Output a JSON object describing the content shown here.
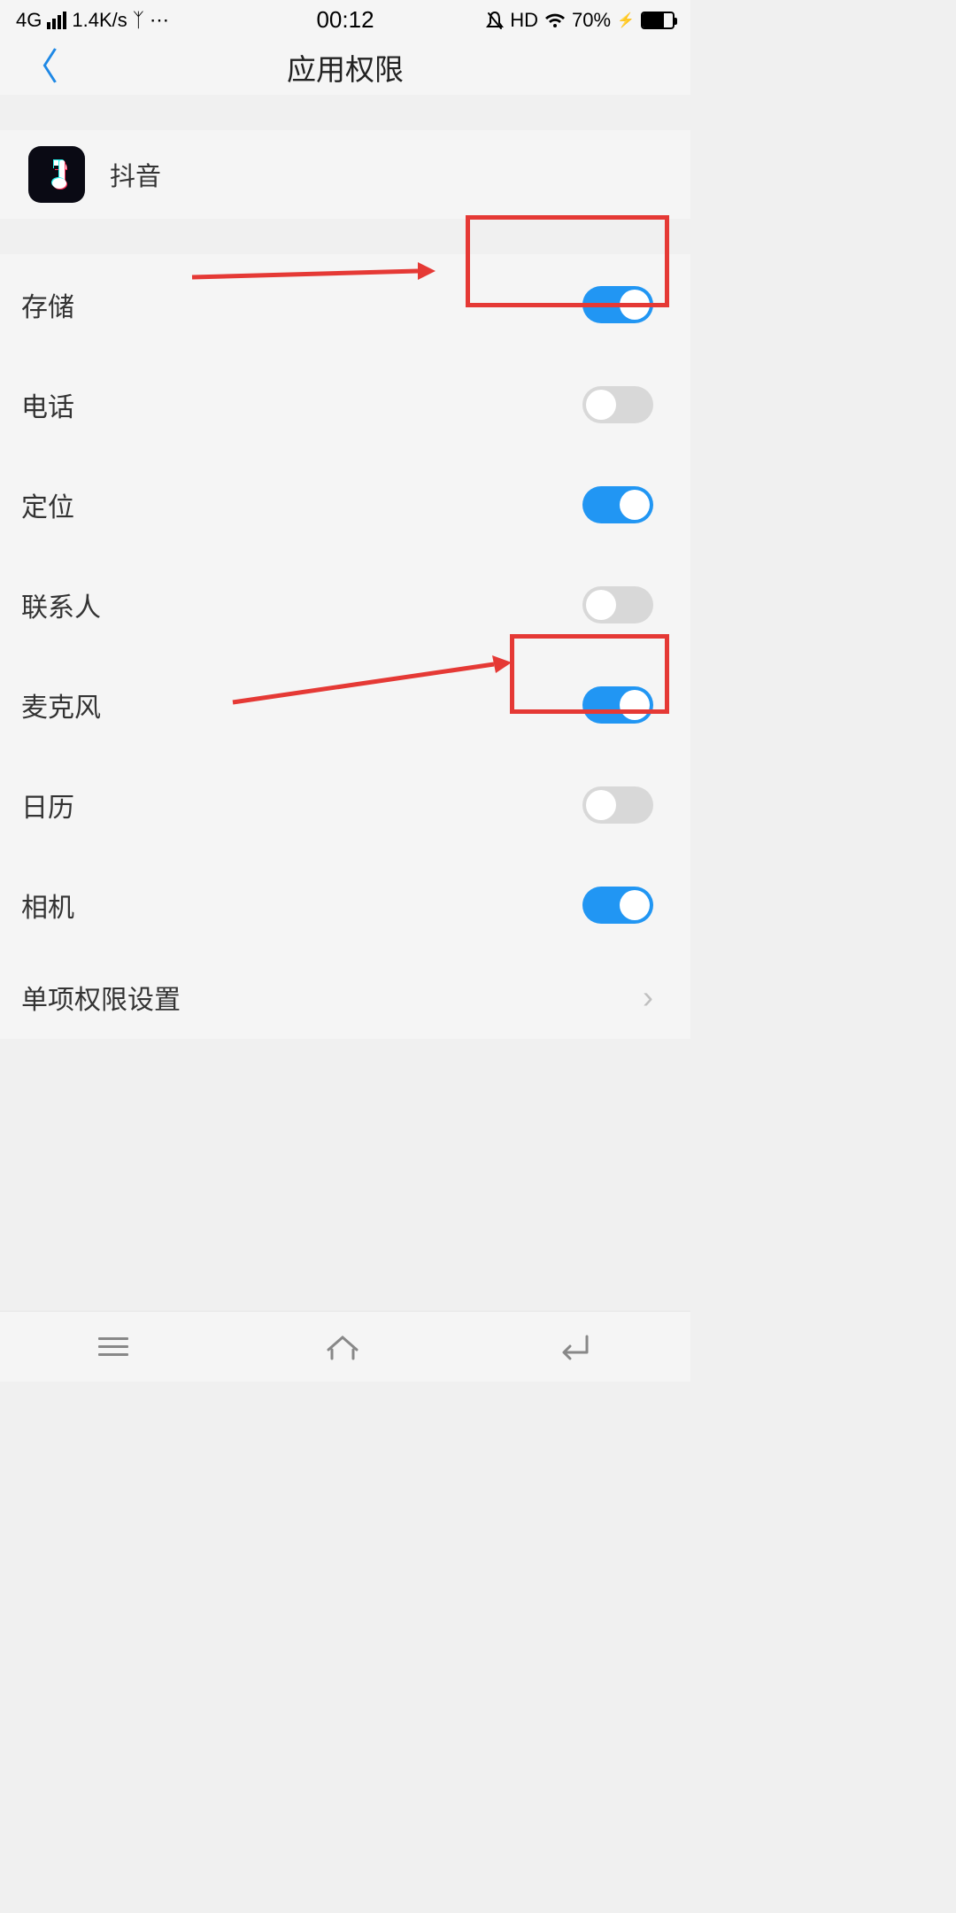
{
  "statusBar": {
    "network": "4G",
    "speed": "1.4K/s",
    "time": "00:12",
    "hd": "HD",
    "battery": "70%"
  },
  "header": {
    "title": "应用权限"
  },
  "app": {
    "name": "抖音"
  },
  "permissions": [
    {
      "label": "存储",
      "enabled": true
    },
    {
      "label": "电话",
      "enabled": false
    },
    {
      "label": "定位",
      "enabled": true
    },
    {
      "label": "联系人",
      "enabled": false
    },
    {
      "label": "麦克风",
      "enabled": true
    },
    {
      "label": "日历",
      "enabled": false
    },
    {
      "label": "相机",
      "enabled": true
    }
  ],
  "link": {
    "label": "单项权限设置"
  }
}
